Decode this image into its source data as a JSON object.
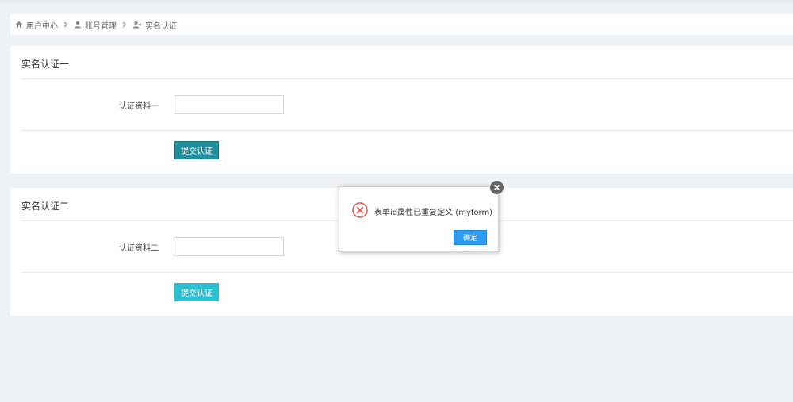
{
  "breadcrumb": {
    "items": [
      {
        "label": "用户中心",
        "icon": "home-icon"
      },
      {
        "label": "账号管理",
        "icon": "user-icon"
      },
      {
        "label": "实名认证",
        "icon": "user-plus-icon"
      }
    ]
  },
  "cards": [
    {
      "title": "实名认证一",
      "field_label": "认证资料一",
      "field_value": "",
      "submit_label": "提交认证"
    },
    {
      "title": "实名认证二",
      "field_label": "认证资料二",
      "field_value": "",
      "submit_label": "提交认证"
    }
  ],
  "dialog": {
    "message": "表单id属性已重复定义 (myform)",
    "ok_label": "确定",
    "icon": "error-circle-icon",
    "close_icon": "close-icon"
  },
  "colors": {
    "page_bg": "#eef1f6",
    "primary_button": "#1f8f9d",
    "secondary_button": "#2bbfd2",
    "dialog_ok": "#2e9bf0",
    "error_icon": "#e2534b"
  }
}
